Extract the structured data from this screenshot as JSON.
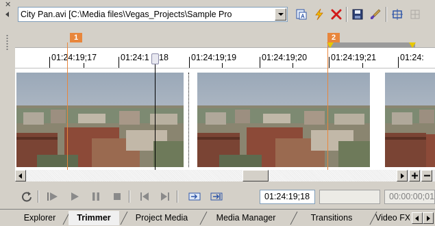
{
  "toolbar": {
    "file_selector_text": "City Pan.avi   [C:\\Media files\\Vegas_Projects\\Sample Pro",
    "icons": [
      "media-properties-icon",
      "lightning-icon",
      "delete-icon",
      "save-icon",
      "brush-icon",
      "snapshot-icon"
    ]
  },
  "markers": {
    "m1_label": "1",
    "m2_label": "2"
  },
  "ruler": {
    "timecodes": [
      "01:24:19;17",
      "01:24:1",
      "18",
      "01:24:19;19",
      "01:24:19;20",
      "01:24:19;21",
      "01:24:"
    ]
  },
  "transport": {
    "current_time": "01:24:19;18",
    "selection_length": "",
    "duration": "00:00:00;01"
  },
  "tabs": [
    "Explorer",
    "Trimmer",
    "Project Media",
    "Media Manager",
    "Transitions",
    "Video FX"
  ],
  "active_tab": "Trimmer",
  "colors": {
    "marker": "#e8863c",
    "loop_end": "#e8c800",
    "toolbar_bg": "#d4d0c8"
  }
}
